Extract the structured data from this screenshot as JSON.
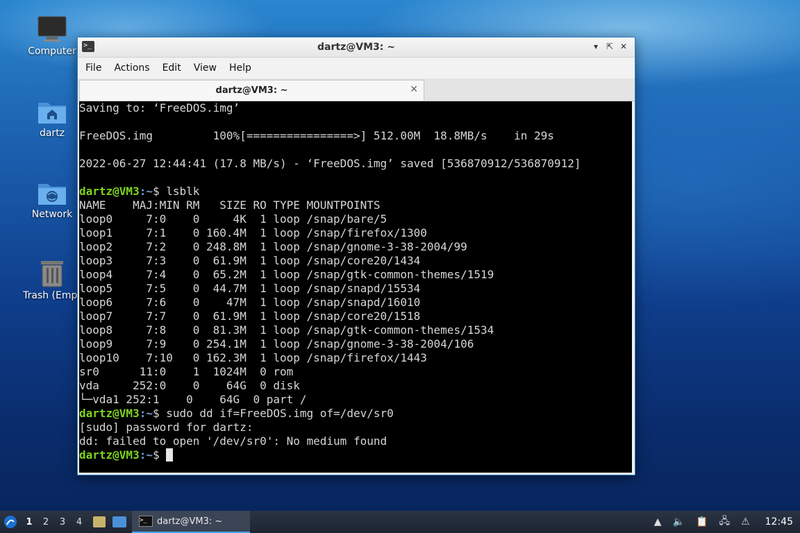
{
  "desktop": {
    "icons": [
      {
        "label": "Computer"
      },
      {
        "label": "dartz"
      },
      {
        "label": "Network"
      },
      {
        "label": "Trash (Empt"
      }
    ]
  },
  "window": {
    "title": "dartz@VM3: ~",
    "menu": [
      "File",
      "Actions",
      "Edit",
      "View",
      "Help"
    ],
    "tab_label": "dartz@VM3: ~"
  },
  "terminal": {
    "prompt_user": "dartz@VM3",
    "prompt_path": ":~",
    "lines": [
      "Saving to: ‘FreeDOS.img’",
      "",
      "FreeDOS.img         100%[================>] 512.00M  18.8MB/s    in 29s",
      "",
      "2022-06-27 12:44:41 (17.8 MB/s) - ‘FreeDOS.img’ saved [536870912/536870912]",
      "",
      "",
      "NAME    MAJ:MIN RM   SIZE RO TYPE MOUNTPOINTS",
      "loop0     7:0    0     4K  1 loop /snap/bare/5",
      "loop1     7:1    0 160.4M  1 loop /snap/firefox/1300",
      "loop2     7:2    0 248.8M  1 loop /snap/gnome-3-38-2004/99",
      "loop3     7:3    0  61.9M  1 loop /snap/core20/1434",
      "loop4     7:4    0  65.2M  1 loop /snap/gtk-common-themes/1519",
      "loop5     7:5    0  44.7M  1 loop /snap/snapd/15534",
      "loop6     7:6    0    47M  1 loop /snap/snapd/16010",
      "loop7     7:7    0  61.9M  1 loop /snap/core20/1518",
      "loop8     7:8    0  81.3M  1 loop /snap/gtk-common-themes/1534",
      "loop9     7:9    0 254.1M  1 loop /snap/gnome-3-38-2004/106",
      "loop10    7:10   0 162.3M  1 loop /snap/firefox/1443",
      "sr0      11:0    1  1024M  0 rom",
      "vda     252:0    0    64G  0 disk",
      "└─vda1 252:1    0    64G  0 part /",
      "",
      "[sudo] password for dartz:",
      "dd: failed to open '/dev/sr0': No medium found",
      ""
    ],
    "cmd_lsblk": "$ lsblk",
    "cmd_dd": "$ sudo dd if=FreeDOS.img of=/dev/sr0",
    "cmd_last": "$ "
  },
  "taskbar": {
    "workspaces": [
      "1",
      "2",
      "3",
      "4"
    ],
    "task_label": "dartz@VM3: ~",
    "clock": "12:45"
  }
}
